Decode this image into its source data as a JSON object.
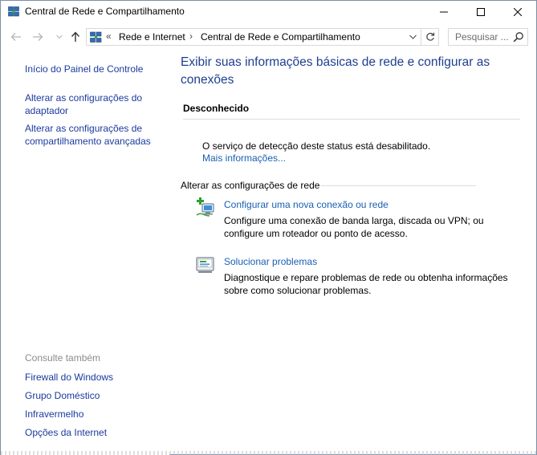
{
  "window": {
    "title": "Central de Rede e Compartilhamento"
  },
  "address": {
    "overflow": "«",
    "crumbs": [
      "Rede e Internet",
      "Central de Rede e Compartilhamento"
    ],
    "separator": "›",
    "search_placeholder": "Pesquisar ..."
  },
  "sidebar": {
    "home": "Início do Painel de Controle",
    "adapter_line1": "Alterar as configurações do",
    "adapter_line2": "adaptador",
    "sharing_line1": "Alterar as configurações de",
    "sharing_line2": "compartilhamento avançadas",
    "see_also": "Consulte também",
    "see_also_links": [
      "Firewall do Windows",
      "Grupo Doméstico",
      "Infravermelho",
      "Opções da Internet"
    ]
  },
  "main": {
    "heading": "Exibir suas informações básicas de rede e configurar as conexões",
    "network_status": "Desconhecido",
    "status_message": "O serviço de detecção deste status está desabilitado.",
    "more_info": "Mais informações...",
    "change_settings_label": "Alterar as configurações de rede",
    "tasks": [
      {
        "title": "Configurar uma nova conexão ou rede",
        "desc": "Configure uma conexão de banda larga, discada ou VPN; ou configure um roteador ou ponto de acesso."
      },
      {
        "title": "Solucionar problemas",
        "desc": "Diagnostique e repare problemas de rede ou obtenha informações sobre como solucionar problemas."
      }
    ]
  },
  "colors": {
    "link": "#1a5fb4",
    "heading": "#1e3f8f",
    "sidebar_link": "#1a3a9e",
    "muted": "#8c8c8c"
  },
  "icons": {
    "app": "network-sharing-icon",
    "new_connection": "new-connection-icon",
    "troubleshoot": "troubleshoot-icon"
  }
}
